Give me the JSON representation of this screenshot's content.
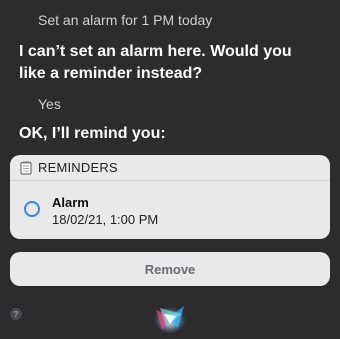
{
  "conversation": {
    "user_request": "Set an alarm for 1 PM today",
    "siri_reply_1": "I can’t set an alarm here. Would you like a reminder instead?",
    "user_reply": "Yes",
    "siri_reply_2": "OK, I’ll remind you:"
  },
  "reminder_card": {
    "header_icon": "reminders-notepad-icon",
    "header_title": "REMINDERS",
    "item": {
      "title": "Alarm",
      "date": "18/02/21, 1:00 PM",
      "accent_color": "#2f88f2"
    }
  },
  "actions": {
    "remove_label": "Remove",
    "help_label": "?"
  },
  "colors": {
    "background": "#2c2c2e",
    "card": "#e9e9ec",
    "accent": "#2f88f2"
  },
  "siri_icon": "siri-orb-icon"
}
